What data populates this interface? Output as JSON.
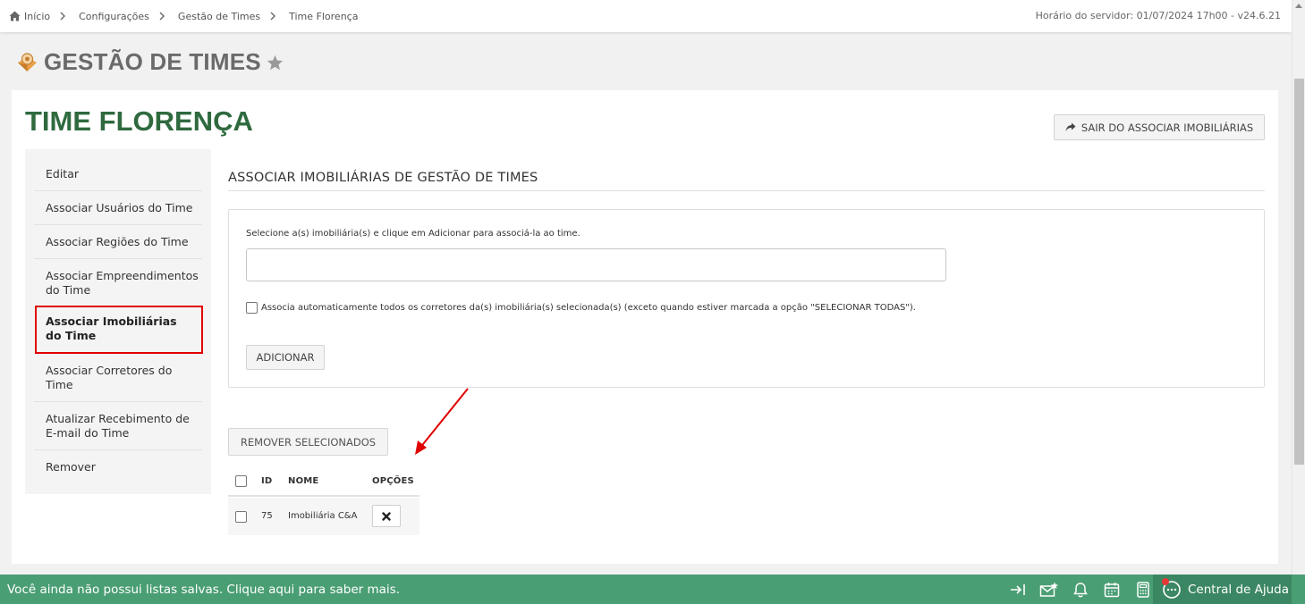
{
  "breadcrumb": {
    "items": [
      "Início",
      "Configurações",
      "Gestão de Times",
      "Time Florença"
    ]
  },
  "server_info": "Horário do servidor: 01/07/2024 17h00 - v24.6.21",
  "page": {
    "title": "GESTÃO DE TIMES"
  },
  "team": {
    "title": "TIME FLORENÇA",
    "exit_button": "SAIR DO ASSOCIAR IMOBILIÁRIAS"
  },
  "sidemenu": {
    "items": [
      "Editar",
      "Associar Usuários do Time",
      "Associar Regiões do Time",
      "Associar Empreendimentos do Time",
      "Associar Imobiliárias do Time",
      "Associar Corretores do Time",
      "Atualizar Recebimento de E-mail do Time",
      "Remover"
    ],
    "active_index": 4
  },
  "section": {
    "title": "ASSOCIAR IMOBILIÁRIAS DE GESTÃO DE TIMES",
    "helper": "Selecione a(s) imobiliária(s) e clique em Adicionar para associá-la ao time.",
    "input_value": "",
    "checkbox_label": "Associa automaticamente todos os corretores da(s) imobiliária(s) selecionada(s) (exceto quando estiver marcada a opção \"SELECIONAR TODAS\").",
    "checkbox_checked": false,
    "add_button": "ADICIONAR",
    "remove_button": "REMOVER SELECIONADOS"
  },
  "table": {
    "columns": [
      "ID",
      "NOME",
      "OPÇÕES"
    ],
    "rows": [
      {
        "id": "75",
        "name": "Imobiliária C&A"
      }
    ]
  },
  "footer": {
    "message": "Você ainda não possui listas salvas. Clique aqui para saber mais.",
    "help_label": "Central de Ajuda",
    "icons": [
      "collapse-right-icon",
      "mail-star-icon",
      "bell-icon",
      "calendar-icon",
      "calculator-icon"
    ]
  },
  "colors": {
    "team_title": "#2f6a3f",
    "footer_bg": "#4a9e74",
    "annotation": "#e00000"
  }
}
